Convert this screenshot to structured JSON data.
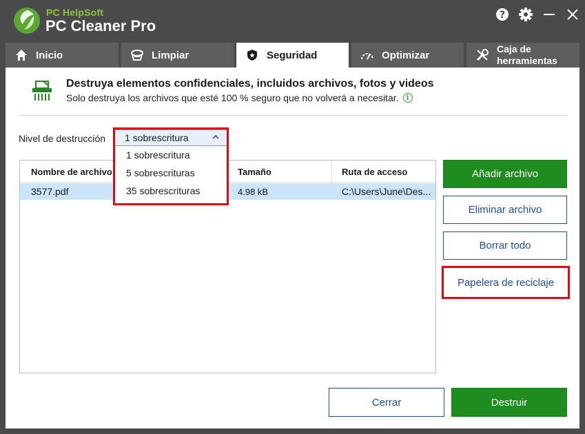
{
  "app": {
    "brand_small": "PC HelpSoft",
    "brand_name": "PC Cleaner Pro"
  },
  "titlebar_icons": [
    "help-icon",
    "gear-icon",
    "minimize-icon",
    "close-icon"
  ],
  "tabs": [
    {
      "label": "Inicio",
      "icon": "home-icon",
      "active": false
    },
    {
      "label": "Limpiar",
      "icon": "broom-icon",
      "active": false
    },
    {
      "label": "Seguridad",
      "icon": "shield-icon",
      "active": true
    },
    {
      "label": "Optimizar",
      "icon": "speedometer-icon",
      "active": false
    },
    {
      "label": "Caja de herramientas",
      "line1": "Caja de",
      "line2": "herramientas",
      "icon": "tools-icon",
      "active": false
    }
  ],
  "header": {
    "title": "Destruya elementos confidenciales, incluidos archivos, fotos y videos",
    "subtitle": "Solo destruya los archivos que esté 100 % seguro que no volverá a necesitar."
  },
  "level": {
    "label": "Nivel de destrucción",
    "selected": "1 sobrescritura",
    "options": [
      "1 sobrescritura",
      "5 sobrescrituras",
      "35 sobrescrituras"
    ]
  },
  "table": {
    "columns": [
      "Nombre de archivo",
      "Tamaño",
      "Ruta de acceso"
    ],
    "rows": [
      {
        "name": "3577.pdf",
        "size": "4.98 kB",
        "path": "C:\\Users\\June\\Des..."
      }
    ]
  },
  "buttons": {
    "add_file": "Añadir archivo",
    "remove_file": "Eliminar archivo",
    "clear_all": "Borrar todo",
    "recycle_bin": "Papelera de reciclaje",
    "close": "Cerrar",
    "destroy": "Destruir"
  },
  "colors": {
    "accent_green": "#1e8c1e",
    "brand_green": "#8cc63f",
    "outline_blue": "#1f4e9a",
    "highlight_red": "#e30613",
    "selection_blue": "#cce4f7"
  }
}
